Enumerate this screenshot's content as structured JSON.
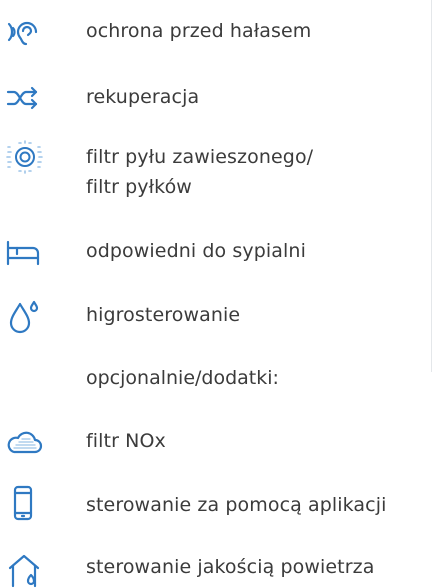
{
  "accent_color": "#2f79c2",
  "features": [
    {
      "icon": "ear-sound-icon",
      "label": "ochrona przed hałasem"
    },
    {
      "icon": "shuffle-recovery-icon",
      "label": "rekuperacja"
    },
    {
      "icon": "filter-ring-icon",
      "label_lines": [
        "filtr pyłu zawieszonego/",
        "filtr pyłków"
      ]
    },
    {
      "icon": "bed-icon",
      "label": "odpowiedni do sypialni"
    },
    {
      "icon": "water-drop-icon",
      "label": "higrosterowanie"
    }
  ],
  "optional_heading": "opcjonalnie/dodatki:",
  "optional_features": [
    {
      "icon": "cloud-filter-icon",
      "label": "filtr NOx"
    },
    {
      "icon": "smartphone-icon",
      "label": "sterowanie za pomocą aplikacji"
    },
    {
      "icon": "house-air-icon",
      "label": "sterowanie jakością powietrza"
    }
  ]
}
